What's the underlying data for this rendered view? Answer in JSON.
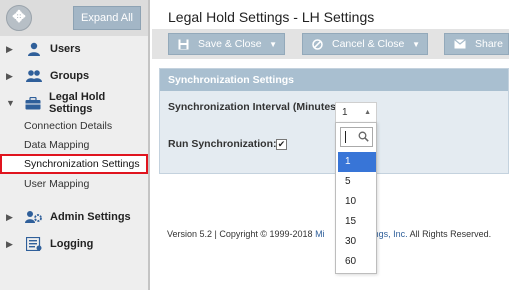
{
  "sidebar": {
    "expand_all": "Expand All",
    "nav": [
      {
        "label": "Users",
        "icon": "user-icon"
      },
      {
        "label": "Groups",
        "icon": "group-icon"
      },
      {
        "label": "Legal Hold Settings",
        "icon": "briefcase-icon"
      },
      {
        "label": "Admin Settings",
        "icon": "admin-settings-icon"
      },
      {
        "label": "Logging",
        "icon": "log-icon"
      }
    ],
    "legal_hold_items": [
      {
        "label": "Connection Details"
      },
      {
        "label": "Data Mapping"
      },
      {
        "label": "Synchronization Settings"
      },
      {
        "label": "User Mapping"
      }
    ]
  },
  "header": {
    "title": "Legal Hold Settings - LH Settings"
  },
  "toolbar": {
    "save_close": "Save & Close",
    "cancel_close": "Cancel & Close",
    "share": "Share"
  },
  "panel": {
    "title": "Synchronization Settings",
    "interval_label": "Synchronization Interval (Minutes):",
    "interval_value": "1",
    "run_label": "Run Synchronization:",
    "run_checked": true,
    "interval_options": [
      "1",
      "5",
      "10",
      "15",
      "30",
      "60"
    ]
  },
  "footer": {
    "prefix": "Version 5.2 | Copyright © 1999-2018 ",
    "link_start": "Mi",
    "link_end": "dings, Inc.",
    "suffix": " All Rights Reserved."
  },
  "colors": {
    "accent": "#a8bccb",
    "panel_header": "#a9bfd0",
    "selected_option": "#3875d7",
    "highlight_border": "#e0141e",
    "icon_blue": "#2f5f9a"
  }
}
